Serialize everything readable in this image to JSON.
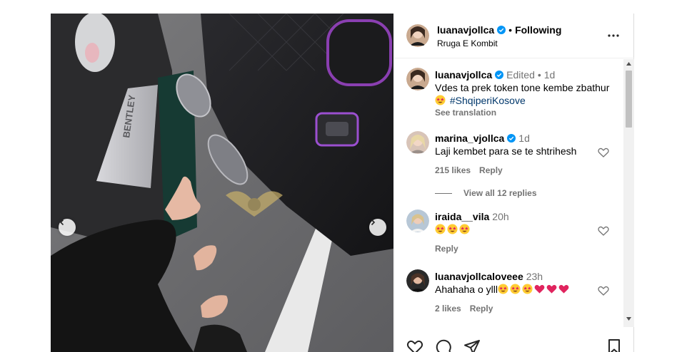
{
  "post": {
    "author": "luanavjollca",
    "follow_state": "Following",
    "location": "Rruga E Kombit",
    "caption_author": "luanavjollca",
    "caption_edited": "Edited",
    "caption_time": "1d",
    "caption_text": "Vdes ta prek token tone kembe zbathur",
    "caption_hashtag": "#ShqiperiKosove",
    "see_translation": "See translation",
    "photo_text": "BENTLEY"
  },
  "comments": [
    {
      "author": "marina_vjollca",
      "time": "1d",
      "text": "Laji kembet para se te shtrihesh",
      "likes": "215 likes",
      "reply": "Reply",
      "view_replies": "View all 12 replies"
    },
    {
      "author": "iraida__vila",
      "time": "20h",
      "reply": "Reply"
    },
    {
      "author": "luanavjollcaloveee",
      "time": "23h",
      "text": "Ahahaha o ylll",
      "likes": "2 likes",
      "reply": "Reply"
    }
  ],
  "icons": {
    "verified": "verified-badge-icon",
    "more": "more-options-icon",
    "heart": "heart-icon",
    "comment": "comment-icon",
    "share": "share-icon",
    "save": "bookmark-icon",
    "emoji_star_eyes": "star-struck-emoji",
    "emoji_heart": "red-heart-emoji"
  },
  "colors": {
    "verified": "#0095f6",
    "hashtag": "#00376b",
    "secondary_text": "#737373",
    "heart_red": "#e0245e"
  }
}
